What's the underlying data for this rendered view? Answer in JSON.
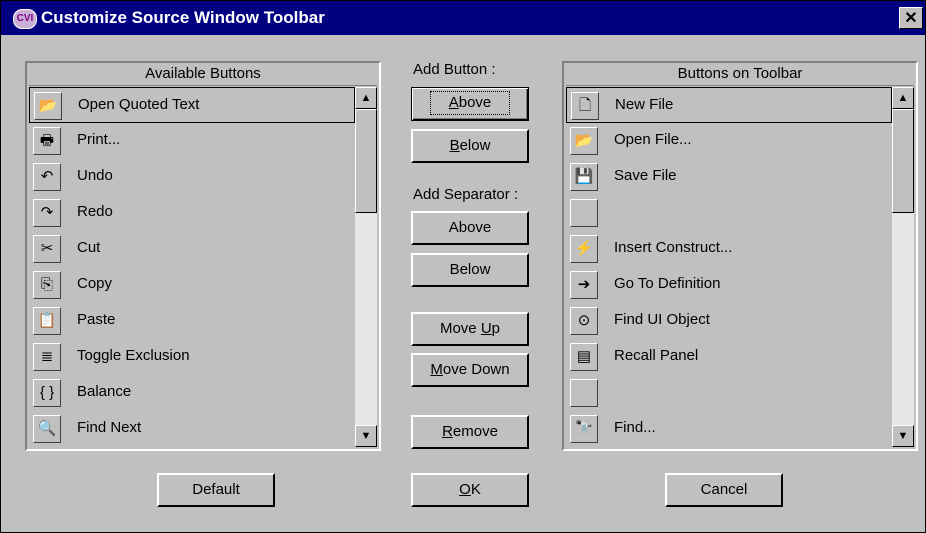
{
  "window": {
    "title": "Customize Source Window Toolbar",
    "icon": "cvi-logo-icon",
    "icon_text": "CVI",
    "close_label": "✕"
  },
  "available": {
    "header": "Available Buttons",
    "items": [
      {
        "label": "Open Quoted Text",
        "icon": "open-quoted-text-icon",
        "glyph": "📂",
        "selected": true
      },
      {
        "label": "Print...",
        "icon": "print-icon",
        "glyph": "🖶"
      },
      {
        "label": "Undo",
        "icon": "undo-icon",
        "glyph": "↶"
      },
      {
        "label": "Redo",
        "icon": "redo-icon",
        "glyph": "↷"
      },
      {
        "label": "Cut",
        "icon": "cut-icon",
        "glyph": "✂"
      },
      {
        "label": "Copy",
        "icon": "copy-icon",
        "glyph": "⎘"
      },
      {
        "label": "Paste",
        "icon": "paste-icon",
        "glyph": "📋"
      },
      {
        "label": "Toggle Exclusion",
        "icon": "toggle-exclusion-icon",
        "glyph": "≣"
      },
      {
        "label": "Balance",
        "icon": "balance-icon",
        "glyph": "{ }"
      },
      {
        "label": "Find Next",
        "icon": "find-next-icon",
        "glyph": "🔍"
      }
    ]
  },
  "toolbar": {
    "header": "Buttons on Toolbar",
    "items": [
      {
        "label": "New File",
        "icon": "new-file-icon",
        "glyph": "🗋",
        "selected": true
      },
      {
        "label": "Open File...",
        "icon": "open-file-icon",
        "glyph": "📂"
      },
      {
        "label": "Save File",
        "icon": "save-file-icon",
        "glyph": "💾"
      },
      {
        "label": "",
        "icon": "separator-icon",
        "glyph": ""
      },
      {
        "label": "Insert Construct...",
        "icon": "insert-construct-icon",
        "glyph": "⚡"
      },
      {
        "label": "Go To Definition",
        "icon": "go-to-definition-icon",
        "glyph": "➔"
      },
      {
        "label": "Find UI Object",
        "icon": "find-ui-object-icon",
        "glyph": "⊙"
      },
      {
        "label": "Recall Panel",
        "icon": "recall-panel-icon",
        "glyph": "▤"
      },
      {
        "label": "",
        "icon": "separator-icon",
        "glyph": ""
      },
      {
        "label": "Find...",
        "icon": "find-icon",
        "glyph": "🔭"
      }
    ]
  },
  "middle": {
    "add_button_label": "Add Button :",
    "add_button_above": {
      "before": "",
      "key": "A",
      "after": "bove"
    },
    "add_button_below": {
      "before": "",
      "key": "B",
      "after": "elow"
    },
    "add_separator_label": "Add Separator :",
    "add_separator_above": "Above",
    "add_separator_below": "Below",
    "move_up": {
      "before": "Move ",
      "key": "U",
      "after": "p"
    },
    "move_down": {
      "before": "",
      "key": "M",
      "after": "ove Down"
    },
    "remove": {
      "before": "",
      "key": "R",
      "after": "emove"
    }
  },
  "footer": {
    "default_label": "Default",
    "ok": {
      "before": "",
      "key": "O",
      "after": "K"
    },
    "cancel_label": "Cancel"
  },
  "scroll_arrows": {
    "up": "▲",
    "down": "▼"
  }
}
